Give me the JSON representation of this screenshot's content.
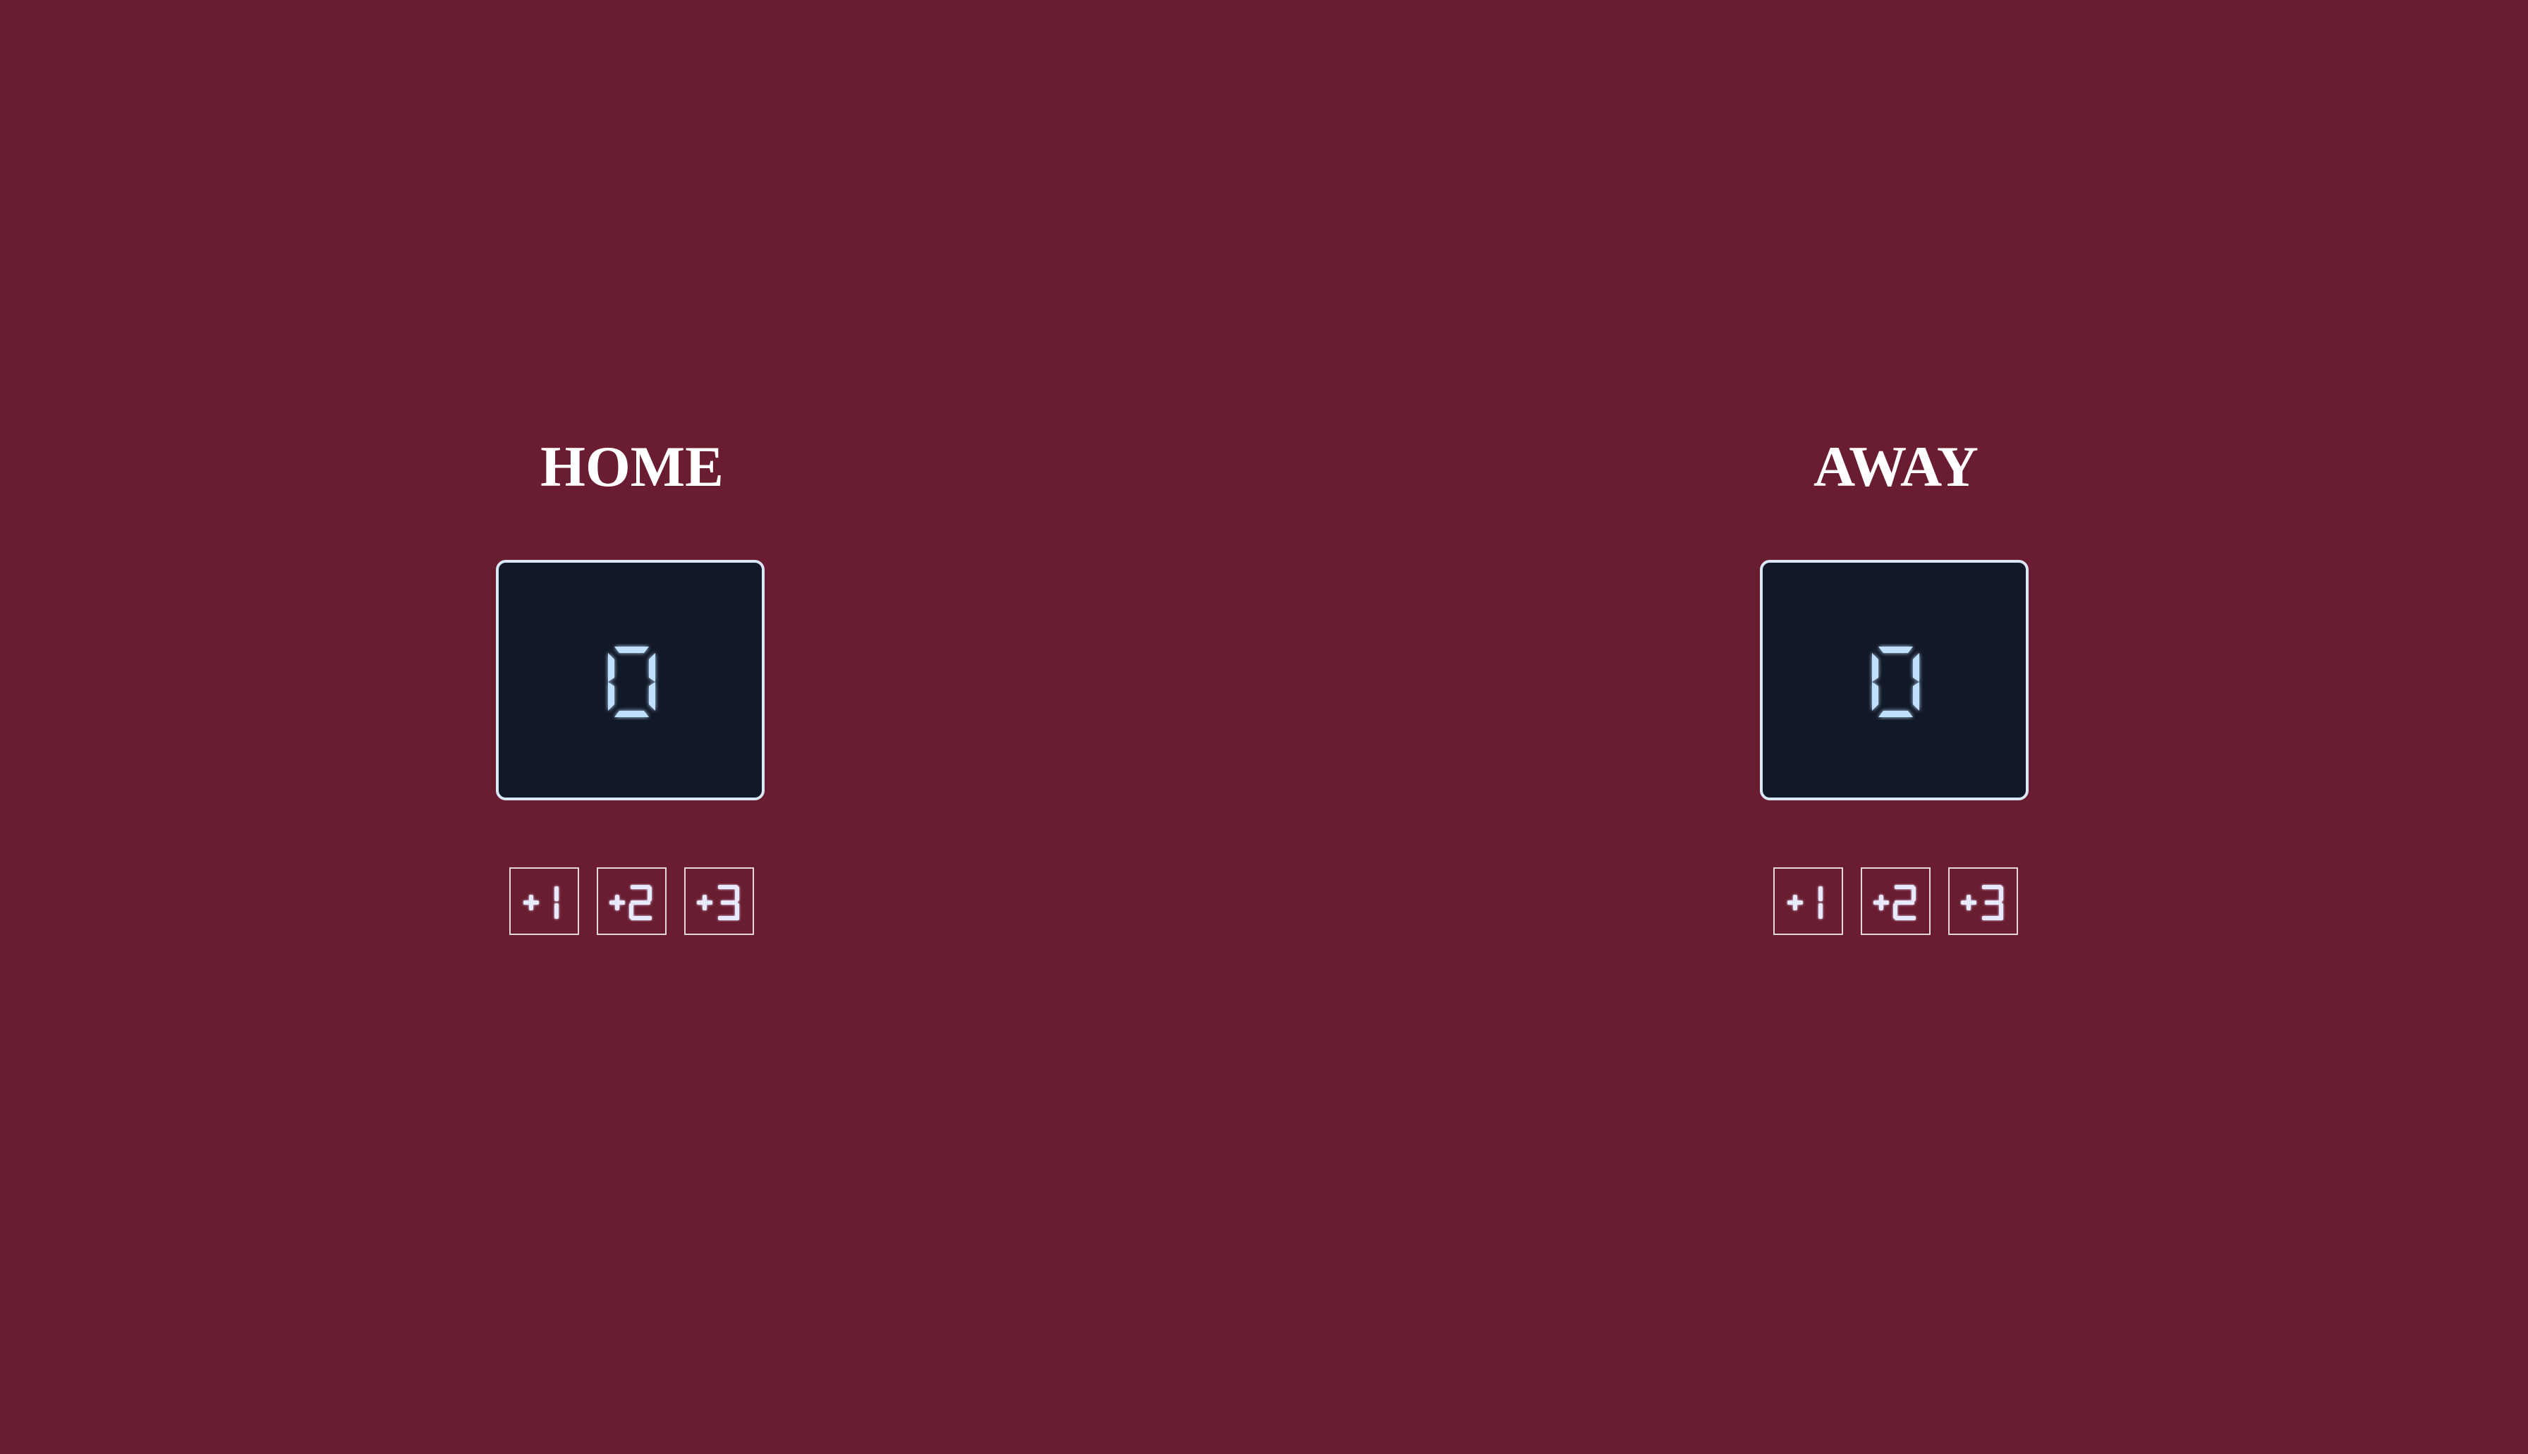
{
  "colors": {
    "background": "#6a1d31",
    "score_panel": "#111827",
    "score_digit": "#bfe0ff",
    "panel_border": "#d9e6f5",
    "title_text": "#ffffff"
  },
  "home": {
    "title": "HOME",
    "score": "0",
    "buttons": [
      {
        "label": "+1"
      },
      {
        "label": "+2"
      },
      {
        "label": "+3"
      }
    ]
  },
  "away": {
    "title": "AWAY",
    "score": "0",
    "buttons": [
      {
        "label": "+1"
      },
      {
        "label": "+2"
      },
      {
        "label": "+3"
      }
    ]
  }
}
